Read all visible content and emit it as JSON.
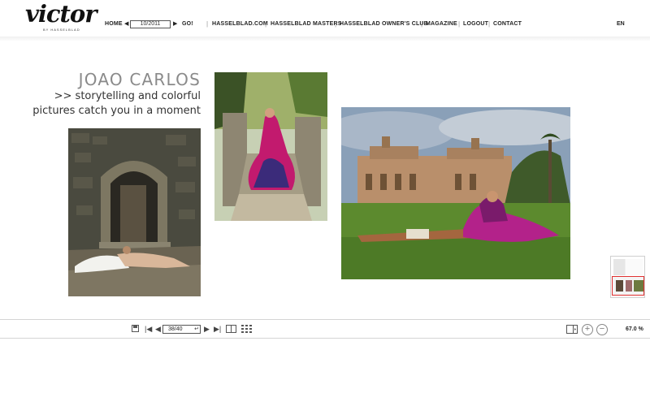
{
  "header": {
    "logo_text": "victor",
    "logo_subtext": "BY HASSELBLAD",
    "nav_home": "HOME",
    "issue_value": "10/2011",
    "nav_go": "GO!",
    "nav_links": [
      "HASSELBLAD.COM",
      "HASSELBLAD MASTERS",
      "HASSELBLAD OWNER'S CLUB",
      "MAGAZINE",
      "LOGOUT",
      "CONTACT"
    ],
    "language": "EN"
  },
  "spread": {
    "photographer": "JOAO CARLOS",
    "tagline_line1": ">> storytelling and colorful",
    "tagline_line2": "pictures catch you in a moment"
  },
  "toolbar": {
    "page_value": "38/40",
    "zoom_level": "67.0 %"
  },
  "icons": [
    "save-icon",
    "first-page-icon",
    "prev-page-icon",
    "next-page-icon",
    "last-page-icon",
    "single-page-view-icon",
    "grid-view-icon",
    "fit-width-icon",
    "zoom-in-icon",
    "zoom-out-icon"
  ]
}
